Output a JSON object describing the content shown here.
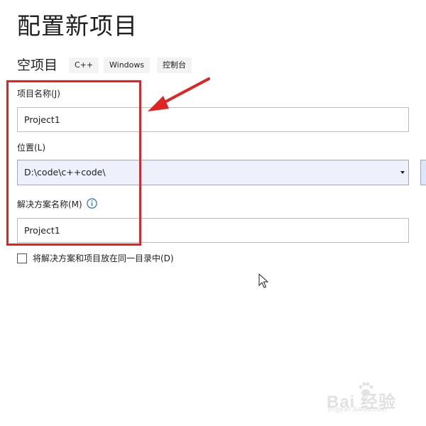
{
  "header": {
    "title": "配置新项目"
  },
  "template": {
    "name": "空项目",
    "tags": [
      "C++",
      "Windows",
      "控制台"
    ]
  },
  "form": {
    "project_name": {
      "label": "项目名称(J)",
      "value": "Project1"
    },
    "location": {
      "label": "位置(L)",
      "value": "D:\\code\\c++code\\"
    },
    "solution_name": {
      "label": "解决方案名称(M)",
      "value": "Project1"
    },
    "same_dir_checkbox": {
      "label": "将解决方案和项目放在同一目录中(D)",
      "checked": false
    }
  },
  "colors": {
    "annotation": "#e02424",
    "combo_background": "#eef1fb"
  },
  "watermark": {
    "brand": "Bai 经验",
    "sub": "jingyan.baidu.com"
  }
}
